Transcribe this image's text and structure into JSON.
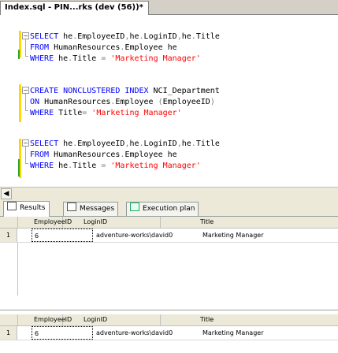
{
  "document_tab": {
    "title": "Index.sql - PIN...rks (dev (56))*"
  },
  "code": [
    {
      "parts": [
        {
          "t": "SELECT",
          "c": "kw"
        },
        {
          "t": " he",
          "c": "plain"
        },
        {
          "t": ".",
          "c": "gray"
        },
        {
          "t": "EmployeeID",
          "c": "plain"
        },
        {
          "t": ",",
          "c": "gray"
        },
        {
          "t": "he",
          "c": "plain"
        },
        {
          "t": ".",
          "c": "gray"
        },
        {
          "t": "LoginID",
          "c": "plain"
        },
        {
          "t": ",",
          "c": "gray"
        },
        {
          "t": "he",
          "c": "plain"
        },
        {
          "t": ".",
          "c": "gray"
        },
        {
          "t": "Title",
          "c": "plain"
        }
      ]
    },
    {
      "parts": [
        {
          "t": "FROM",
          "c": "kw"
        },
        {
          "t": " HumanResources",
          "c": "plain"
        },
        {
          "t": ".",
          "c": "gray"
        },
        {
          "t": "Employee he",
          "c": "plain"
        }
      ]
    },
    {
      "parts": [
        {
          "t": "WHERE",
          "c": "kw"
        },
        {
          "t": " he",
          "c": "plain"
        },
        {
          "t": ".",
          "c": "gray"
        },
        {
          "t": "Title ",
          "c": "plain"
        },
        {
          "t": "=",
          "c": "gray"
        },
        {
          "t": " ",
          "c": "plain"
        },
        {
          "t": "'Marketing Manager'",
          "c": "str"
        }
      ]
    },
    {
      "parts": []
    },
    {
      "parts": [
        {
          "t": "CREATE NONCLUSTERED INDEX",
          "c": "kw"
        },
        {
          "t": " NCI_Department",
          "c": "plain"
        }
      ]
    },
    {
      "parts": [
        {
          "t": "ON",
          "c": "kw"
        },
        {
          "t": " HumanResources",
          "c": "plain"
        },
        {
          "t": ".",
          "c": "gray"
        },
        {
          "t": "Employee ",
          "c": "plain"
        },
        {
          "t": "(",
          "c": "gray"
        },
        {
          "t": "EmployeeID",
          "c": "plain"
        },
        {
          "t": ")",
          "c": "gray"
        }
      ]
    },
    {
      "parts": [
        {
          "t": "WHERE",
          "c": "kw"
        },
        {
          "t": " Title",
          "c": "plain"
        },
        {
          "t": "=",
          "c": "gray"
        },
        {
          "t": " ",
          "c": "plain"
        },
        {
          "t": "'Marketing Manager'",
          "c": "str"
        }
      ]
    },
    {
      "parts": []
    },
    {
      "parts": [
        {
          "t": "SELECT",
          "c": "kw"
        },
        {
          "t": " he",
          "c": "plain"
        },
        {
          "t": ".",
          "c": "gray"
        },
        {
          "t": "EmployeeID",
          "c": "plain"
        },
        {
          "t": ",",
          "c": "gray"
        },
        {
          "t": "he",
          "c": "plain"
        },
        {
          "t": ".",
          "c": "gray"
        },
        {
          "t": "LoginID",
          "c": "plain"
        },
        {
          "t": ",",
          "c": "gray"
        },
        {
          "t": "he",
          "c": "plain"
        },
        {
          "t": ".",
          "c": "gray"
        },
        {
          "t": "Title",
          "c": "plain"
        }
      ]
    },
    {
      "parts": [
        {
          "t": "FROM",
          "c": "kw"
        },
        {
          "t": " HumanResources",
          "c": "plain"
        },
        {
          "t": ".",
          "c": "gray"
        },
        {
          "t": "Employee he",
          "c": "plain"
        }
      ]
    },
    {
      "parts": [
        {
          "t": "WHERE",
          "c": "kw"
        },
        {
          "t": " he",
          "c": "plain"
        },
        {
          "t": ".",
          "c": "gray"
        },
        {
          "t": "Title ",
          "c": "plain"
        },
        {
          "t": "=",
          "c": "gray"
        },
        {
          "t": " ",
          "c": "plain"
        },
        {
          "t": "'Marketing Manager'",
          "c": "str"
        }
      ]
    }
  ],
  "result_tabs": [
    {
      "label": "Results",
      "icon": "grid-icon"
    },
    {
      "label": "Messages",
      "icon": "messages-icon"
    },
    {
      "label": "Execution plan",
      "icon": "execution-plan-icon"
    }
  ],
  "grids": [
    {
      "columns": [
        "EmployeeID",
        "LoginID",
        "Title"
      ],
      "rows": [
        {
          "num": "1",
          "cells": [
            "6",
            "adventure-works\\david0",
            "Marketing Manager"
          ]
        }
      ]
    },
    {
      "columns": [
        "EmployeeID",
        "LoginID",
        "Title"
      ],
      "rows": [
        {
          "num": "1",
          "cells": [
            "6",
            "adventure-works\\david0",
            "Marketing Manager"
          ]
        }
      ]
    }
  ],
  "colors": {
    "keyword": "#0000ff",
    "string": "#ff0000",
    "operator": "#808080",
    "change_bar": "#ffd800",
    "saved_bar": "#2aa52a"
  }
}
